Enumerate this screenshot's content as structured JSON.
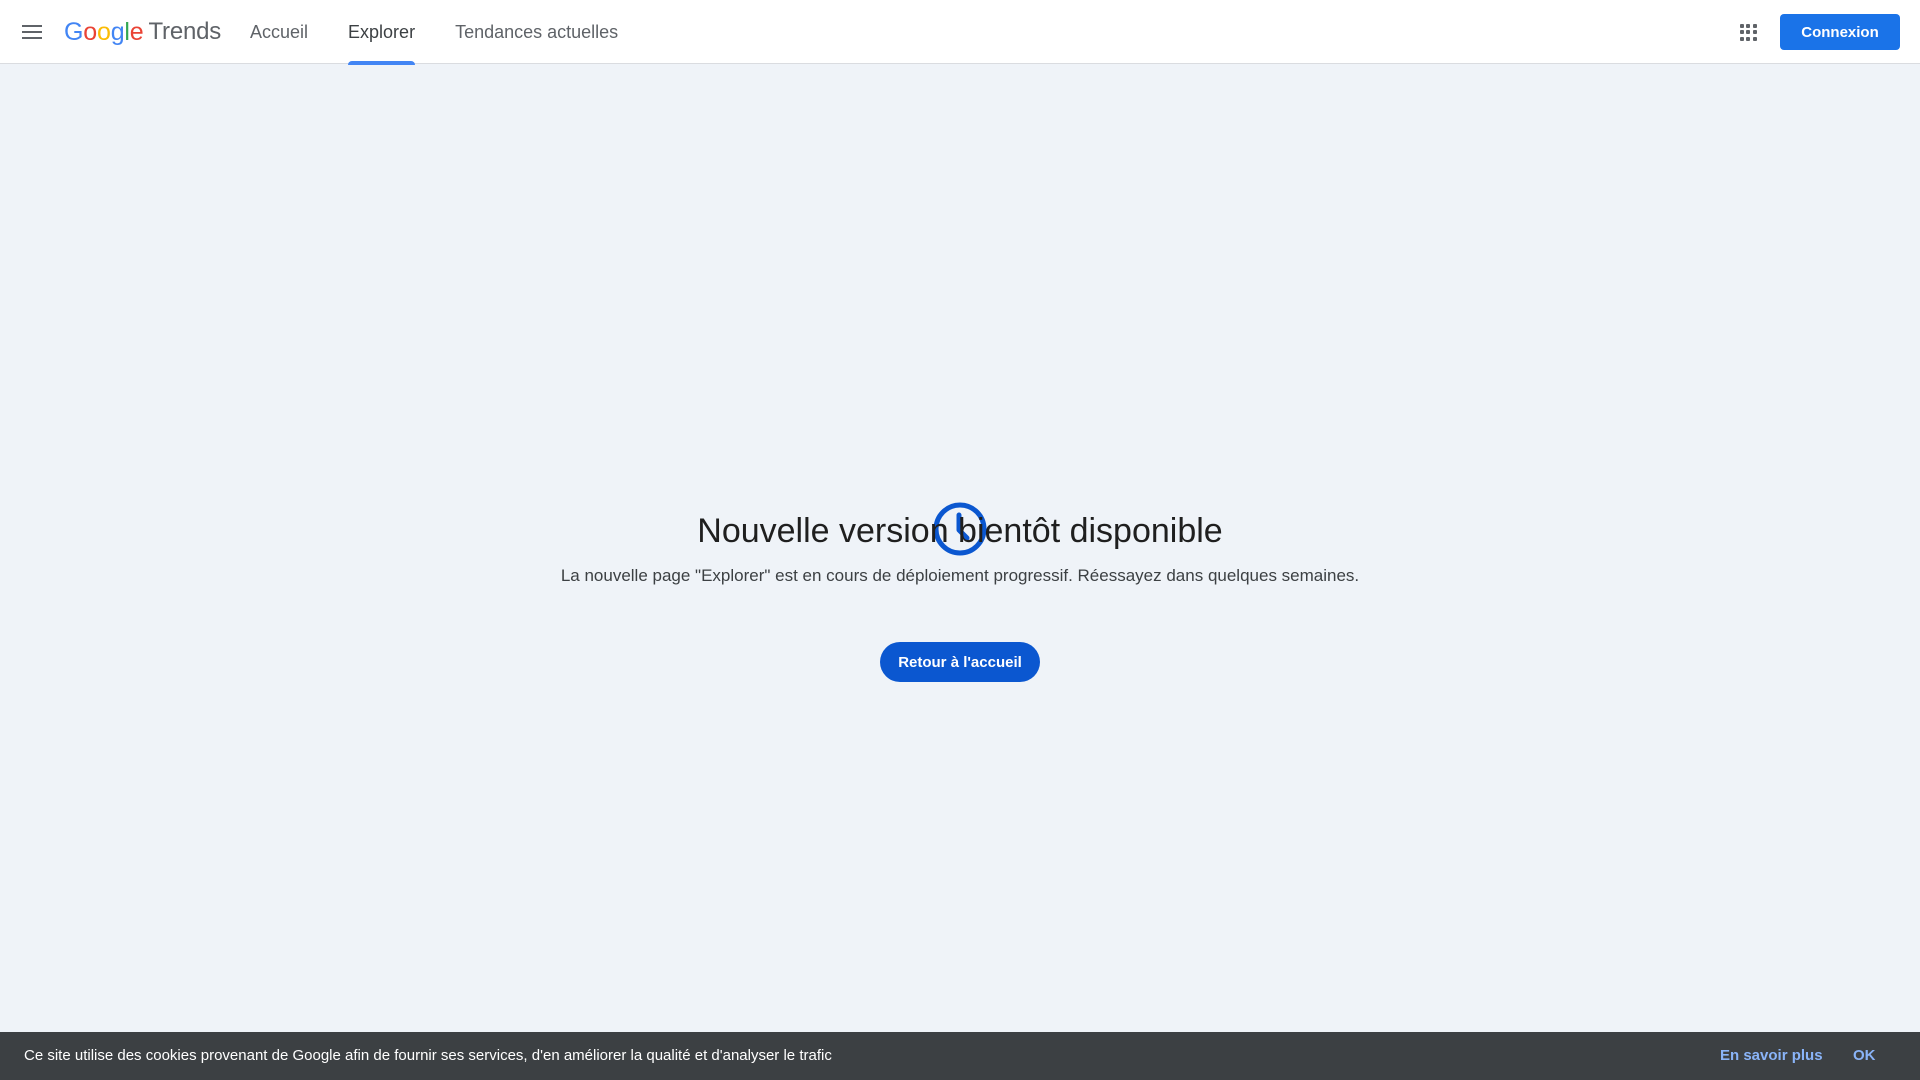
{
  "header": {
    "logo": {
      "google": [
        "G",
        "o",
        "o",
        "g",
        "l",
        "e"
      ],
      "product": "Trends"
    },
    "nav": [
      {
        "label": "Accueil",
        "active": false
      },
      {
        "label": "Explorer",
        "active": true
      },
      {
        "label": "Tendances actuelles",
        "active": false
      }
    ],
    "signin_label": "Connexion"
  },
  "main": {
    "icon": "clock-icon",
    "title": "Nouvelle version bientôt disponible",
    "message": "La nouvelle page \"Explorer\" est en cours de déploiement progressif. Réessayez dans quelques semaines.",
    "button_label": "Retour à l'accueil"
  },
  "cookie": {
    "text": "Ce site utilise des cookies provenant de Google afin de fournir ses services, d'en améliorer la qualité et d'analyser le trafic",
    "learn_more": "En savoir plus",
    "ok": "OK"
  },
  "colors": {
    "accent": "#1a73e8",
    "primary_button": "#0b57d0",
    "icon": "#0b57d0",
    "background": "#eff3f8",
    "cookie_bar": "#3c4043",
    "cookie_link": "#8ab4f8"
  }
}
